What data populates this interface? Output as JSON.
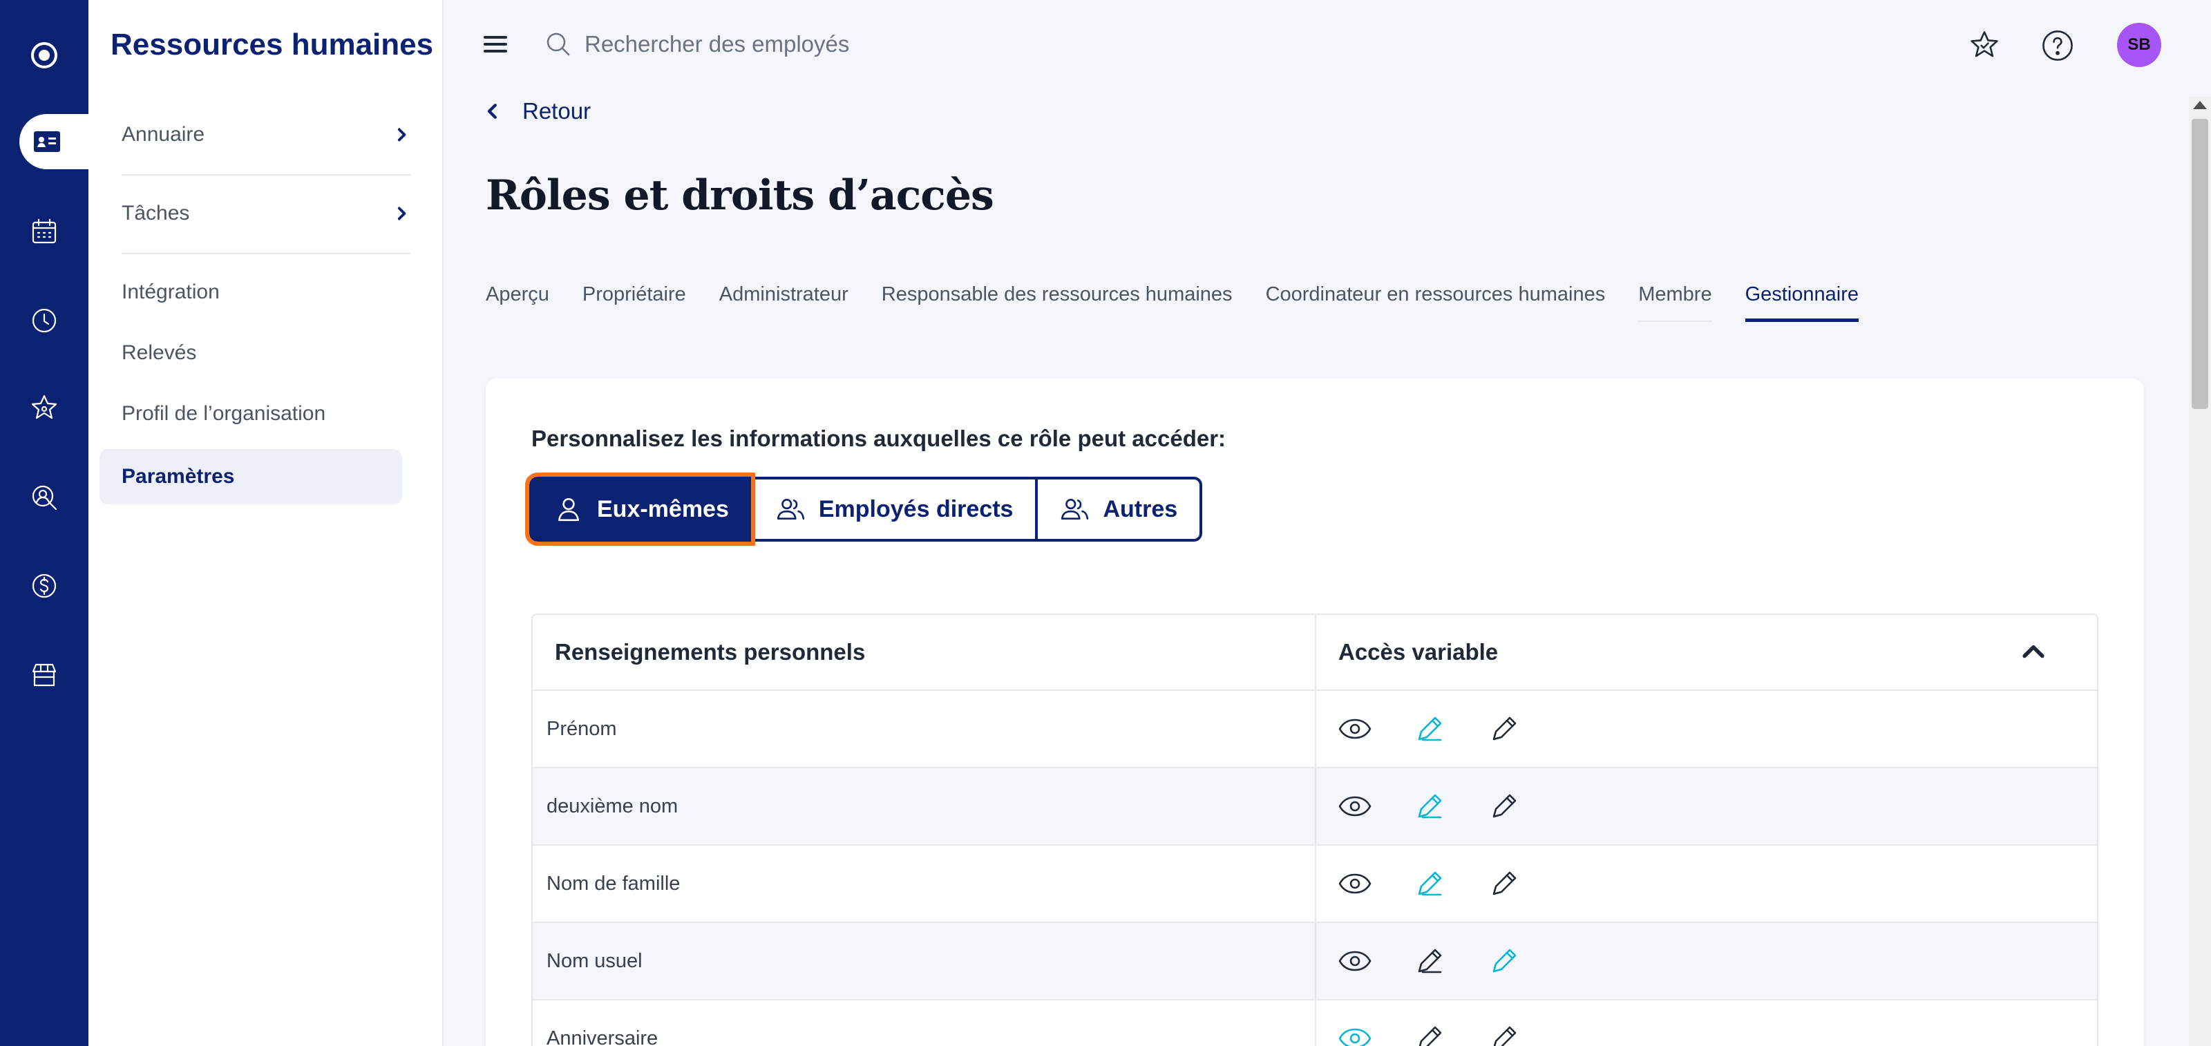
{
  "rail": {
    "items": [
      {
        "name": "logo-icon"
      },
      {
        "name": "employee-card-icon",
        "active": true
      },
      {
        "name": "calendar-icon"
      },
      {
        "name": "clock-icon"
      },
      {
        "name": "star-icon"
      },
      {
        "name": "people-search-icon"
      },
      {
        "name": "dollar-icon"
      },
      {
        "name": "store-icon"
      }
    ]
  },
  "sidenav": {
    "title": "Ressources humaines",
    "items": [
      {
        "label": "Annuaire"
      },
      {
        "label": "Tâches"
      },
      {
        "label": "Intégration"
      },
      {
        "label": "Relevés"
      },
      {
        "label": "Profil de l’organisation"
      },
      {
        "label": "Paramètres"
      }
    ]
  },
  "topbar": {
    "search_placeholder": "Rechercher des employés",
    "avatar_initials": "SB",
    "avatar_color": "#a855f7"
  },
  "back_label": "Retour",
  "page_title": "Rôles et droits d’accès",
  "tabs": [
    {
      "label": "Aperçu"
    },
    {
      "label": "Propriétaire"
    },
    {
      "label": "Administrateur"
    },
    {
      "label": "Responsable des ressources humaines"
    },
    {
      "label": "Coordinateur en ressources humaines"
    },
    {
      "label": "Membre"
    },
    {
      "label": "Gestionnaire",
      "active": true
    }
  ],
  "card": {
    "heading": "Personnalisez les informations auxquelles ce rôle peut accéder:",
    "segments": [
      {
        "label": "Eux-mêmes",
        "active": true
      },
      {
        "label": "Employés directs"
      },
      {
        "label": "Autres"
      }
    ],
    "table": {
      "col1_header": "Renseignements personnels",
      "col2_header": "Accès variable",
      "rows": [
        {
          "label": "Prénom",
          "selected": "edit-own"
        },
        {
          "label": "deuxième nom",
          "selected": "edit-own"
        },
        {
          "label": "Nom de famille",
          "selected": "edit-own"
        },
        {
          "label": "Nom usuel",
          "selected": "edit"
        },
        {
          "label": "Anniversaire",
          "selected": "view"
        }
      ]
    }
  },
  "colors": {
    "brand": "#0b2171",
    "accent": "#06b6d4",
    "focus": "#f97316"
  }
}
